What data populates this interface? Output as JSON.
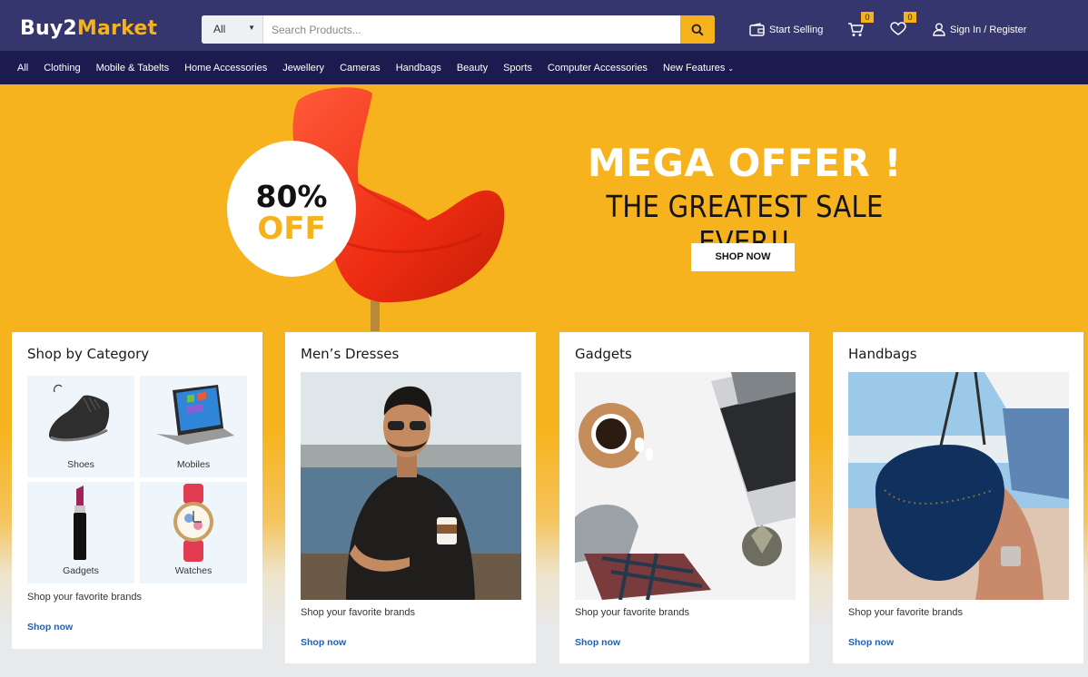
{
  "header": {
    "logo_main": "Buy2",
    "logo_accent": "Market",
    "search_category": "All",
    "search_placeholder": "Search Products...",
    "start_selling": "Start Selling",
    "cart_count": "0",
    "wishlist_count": "0",
    "sign_in": "Sign In / Register",
    "accent_color": "#f7b21b",
    "bg_color": "#34366d"
  },
  "nav": {
    "items": [
      "All",
      "Clothing",
      "Mobile & Tabelts",
      "Home Accessories",
      "Jewellery",
      "Cameras",
      "Handbags",
      "Beauty",
      "Sports",
      "Computer Accessories",
      "New Features"
    ],
    "bg_color": "#1c1b4f"
  },
  "banner": {
    "discount_pct": "80%",
    "discount_off": "OFF",
    "headline": "MEGA OFFER !",
    "subheadline": "THE GREATEST SALE EVER!!",
    "cta": "SHOP NOW",
    "bg_color": "#f7b31e"
  },
  "cards": [
    {
      "title": "Shop by Category",
      "categories": [
        "Shoes",
        "Mobiles",
        "Gadgets",
        "Watches"
      ],
      "description": "Shop your favorite brands",
      "link": "Shop now"
    },
    {
      "title": "Men’s Dresses",
      "description": "Shop your favorite brands",
      "link": "Shop now"
    },
    {
      "title": "Gadgets",
      "description": "Shop your favorite brands",
      "link": "Shop now"
    },
    {
      "title": "Handbags",
      "description": "Shop your favorite brands",
      "link": "Shop now"
    }
  ]
}
